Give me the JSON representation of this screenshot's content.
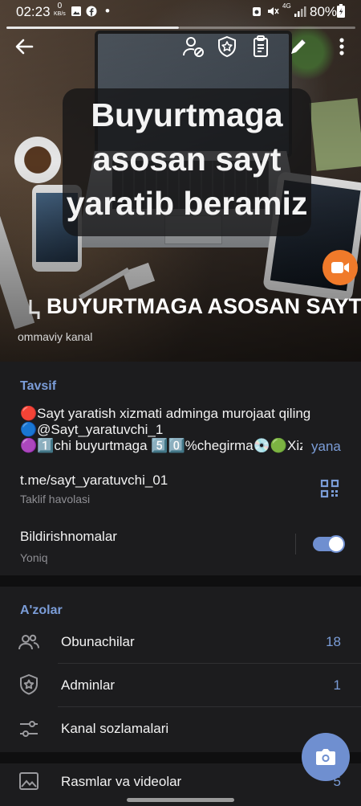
{
  "status_bar": {
    "time": "02:23",
    "speed": "0",
    "speed_unit": "KB/s",
    "network": "4G",
    "battery": "80%"
  },
  "hero": {
    "overlay_line1": "Buyurtmaga",
    "overlay_line2": "asosan sayt",
    "overlay_line3": "yaratib beramiz",
    "channel_title": "BUYURTMAGA ASOSAN SAYT",
    "channel_type": "ommaviy kanal"
  },
  "description": {
    "label": "Tavsif",
    "line1": "🔴Sayt yaratish xizmati adminga murojaat qiling",
    "line2": "🔵@Sayt_yaratuvchi_1",
    "line3": "🟣1️⃣chi buyurtmaga 5️⃣0️⃣%chegirma💿🟢Xiz",
    "more": "yana"
  },
  "link": {
    "value": "t.me/sayt_yaratuvchi_01",
    "caption": "Taklif havolasi"
  },
  "notifications": {
    "title": "Bildirishnomalar",
    "state": "Yoniq",
    "enabled": true
  },
  "members": {
    "label": "A'zolar",
    "items": [
      {
        "label": "Obunachilar",
        "count": "18",
        "icon": "people-icon"
      },
      {
        "label": "Adminlar",
        "count": "1",
        "icon": "admin-shield-icon"
      },
      {
        "label": "Kanal sozlamalari",
        "count": "",
        "icon": "settings-sliders-icon"
      }
    ]
  },
  "media": {
    "label": "Rasmlar va videolar",
    "count": "5"
  },
  "colors": {
    "accent": "#6f8fd0",
    "video_fab": "#f07a2a",
    "background": "#1c1c1e"
  }
}
